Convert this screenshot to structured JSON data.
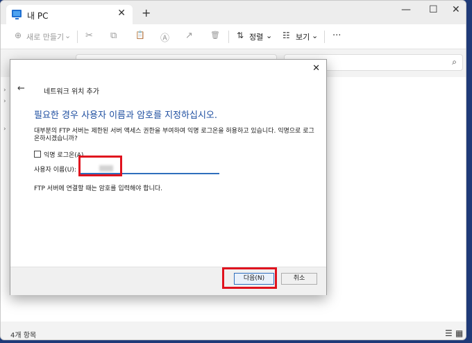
{
  "window": {
    "tab_title": "내 PC",
    "tab_close": "✕",
    "new_tab": "+",
    "minimize": "—",
    "maximize": "☐",
    "close": "✕"
  },
  "toolbar": {
    "new_label": "새로 만들기",
    "new_chevron": "⌄",
    "cut_icon": "✂",
    "copy_icon": "⧉",
    "paste_icon": "📋",
    "rename_icon": "Ⓐ",
    "share_icon": "↗",
    "delete_icon": "🗑",
    "sort_label": "정렬",
    "view_label": "보기",
    "more": "···"
  },
  "search": {
    "icon": "⌕"
  },
  "status": {
    "items": "4개 항목",
    "details_icon": "☰",
    "tiles_icon": "▦"
  },
  "dialog": {
    "close": "✕",
    "back": "←",
    "header": "네트워크 위치 추가",
    "heading": "필요한 경우 사용자 이름과 암호를 지정하십시오.",
    "description": "대부분의 FTP 서버는 제한된 서버 액세스 권한을 부여하여 익명 로그온을 허용하고 있습니다. 익명으로 로그온하시겠습니까?",
    "anonymous_label": "익명 로그온(A)",
    "anonymous_checked": false,
    "username_label": "사용자 이름(U):",
    "note": "FTP 서버에 연결할 때는 암호를 입력해야 합니다.",
    "next_button": "다음(N)",
    "cancel_button": "취소"
  },
  "colors": {
    "highlight": "#e0121e",
    "accent": "#2f6fbd",
    "heading": "#1e4ea0"
  }
}
